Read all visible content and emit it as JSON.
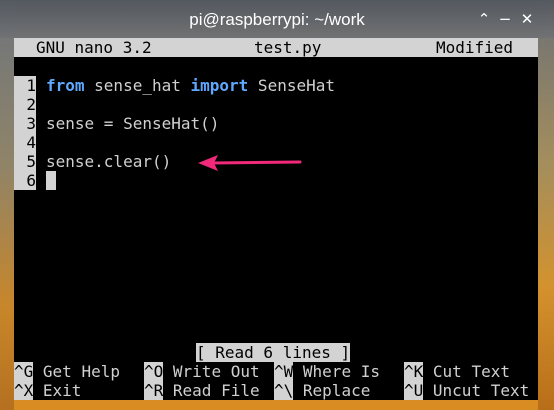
{
  "window": {
    "title": "pi@raspberrypi: ~/work",
    "buttons": [
      "⌃",
      "−",
      "✕"
    ]
  },
  "nano": {
    "version_label": "GNU nano 3.2",
    "filename": "test.py",
    "state": "Modified"
  },
  "lines": [
    {
      "num": "1",
      "kw1": "from",
      "mid": " sense_hat ",
      "kw2": "import",
      "tail": " SenseHat"
    },
    {
      "num": "2",
      "text": ""
    },
    {
      "num": "3",
      "text": "sense = SenseHat()"
    },
    {
      "num": "4",
      "text": ""
    },
    {
      "num": "5",
      "text": "sense.clear()"
    },
    {
      "num": "6",
      "text": ""
    }
  ],
  "status_message": "[ Read 6 lines ]",
  "shortcuts_row1": [
    {
      "key": "^G",
      "label": "Get Help"
    },
    {
      "key": "^O",
      "label": "Write Out"
    },
    {
      "key": "^W",
      "label": "Where Is"
    },
    {
      "key": "^K",
      "label": "Cut Text"
    }
  ],
  "shortcuts_row2": [
    {
      "key": "^X",
      "label": "Exit"
    },
    {
      "key": "^R",
      "label": "Read File"
    },
    {
      "key": "^\\",
      "label": "Replace"
    },
    {
      "key": "^U",
      "label": "Uncut Text"
    }
  ],
  "colors": {
    "keyword": "#5fa8ff",
    "annotation_arrow": "#f0297a"
  }
}
